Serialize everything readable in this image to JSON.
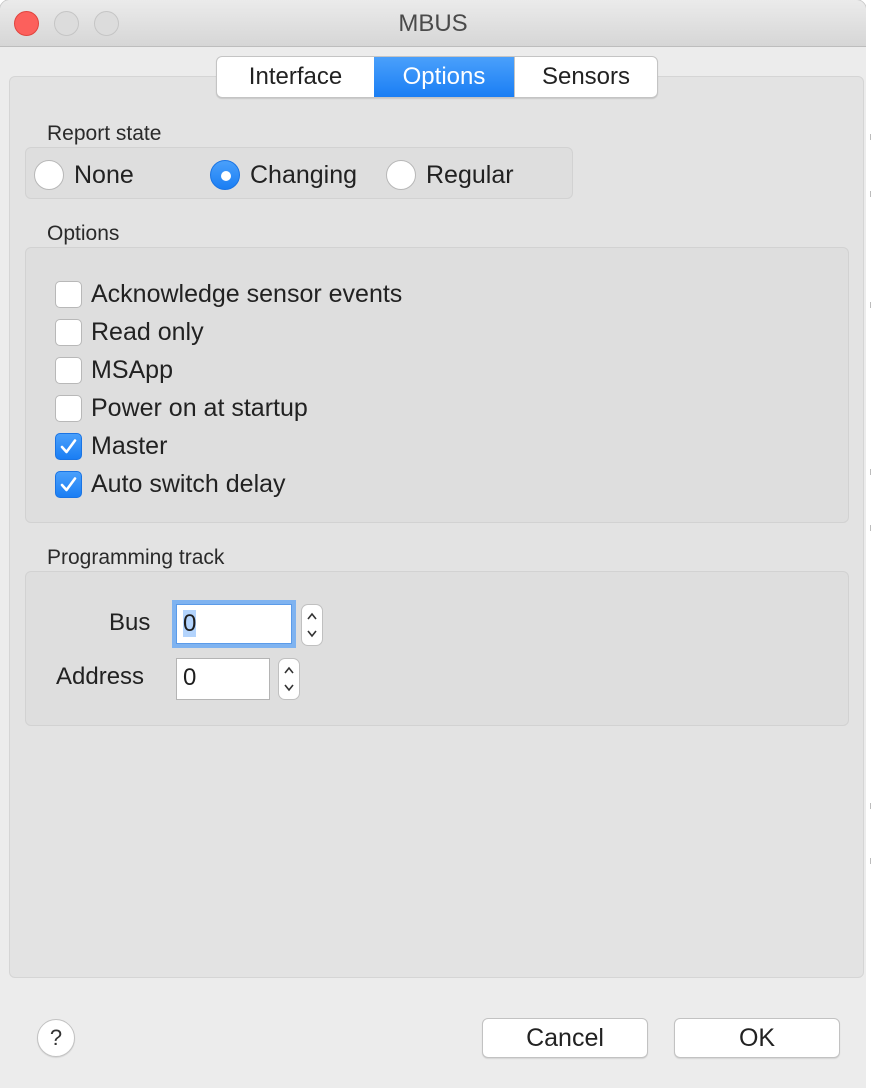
{
  "window": {
    "title": "MBUS"
  },
  "tabs": [
    {
      "label": "Interface",
      "selected": false
    },
    {
      "label": "Options",
      "selected": true
    },
    {
      "label": "Sensors",
      "selected": false
    }
  ],
  "report_state": {
    "label": "Report state",
    "options": [
      {
        "label": "None",
        "selected": false
      },
      {
        "label": "Changing",
        "selected": true
      },
      {
        "label": "Regular",
        "selected": false
      }
    ]
  },
  "options": {
    "label": "Options",
    "items": [
      {
        "label": "Acknowledge sensor events",
        "checked": false
      },
      {
        "label": "Read only",
        "checked": false
      },
      {
        "label": "MSApp",
        "checked": false
      },
      {
        "label": "Power on at startup",
        "checked": false
      },
      {
        "label": "Master",
        "checked": true
      },
      {
        "label": "Auto switch delay",
        "checked": true
      }
    ]
  },
  "programming_track": {
    "label": "Programming track",
    "bus": {
      "label": "Bus",
      "value": "0"
    },
    "address": {
      "label": "Address",
      "value": "0"
    }
  },
  "footer": {
    "help": "?",
    "cancel": "Cancel",
    "ok": "OK"
  },
  "colors": {
    "accent": "#1a7ef4",
    "window_bg": "#ececec",
    "close": "#fc605c"
  }
}
